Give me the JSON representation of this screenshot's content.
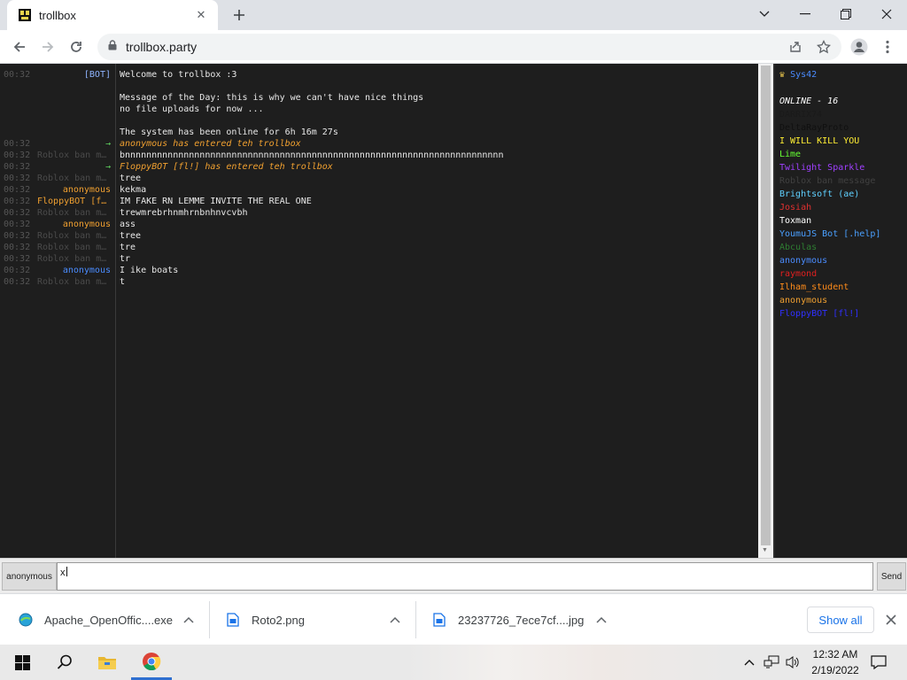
{
  "browser": {
    "tab_title": "trollbox",
    "url": "trollbox.party"
  },
  "chat": {
    "messages": [
      {
        "time": "00:32",
        "nick": "[BOT]",
        "nick_color": "#8fb5ff",
        "text": "Welcome to trollbox :3",
        "text_color": "#e8e8e8",
        "italic": false
      },
      {
        "time": "",
        "nick": "",
        "nick_color": "#8fb5ff",
        "text": "",
        "text_color": "#e8e8e8",
        "italic": false
      },
      {
        "time": "",
        "nick": "",
        "nick_color": "#8fb5ff",
        "text": "Message of the Day: this is why we can't have nice things",
        "text_color": "#e8e8e8",
        "italic": false
      },
      {
        "time": "",
        "nick": "",
        "nick_color": "#8fb5ff",
        "text": "no file uploads for now ...",
        "text_color": "#e8e8e8",
        "italic": false
      },
      {
        "time": "",
        "nick": "",
        "nick_color": "#8fb5ff",
        "text": "",
        "text_color": "#e8e8e8",
        "italic": false
      },
      {
        "time": "",
        "nick": "",
        "nick_color": "#8fb5ff",
        "text": "The system has been online for 6h 16m 27s",
        "text_color": "#e8e8e8",
        "italic": false
      },
      {
        "time": "00:32",
        "nick": "→",
        "nick_color": "#5fd35f",
        "text": "anonymous has entered teh trollbox",
        "text_color": "#f0a030",
        "italic": true
      },
      {
        "time": "00:32",
        "nick": "Roblox ban m...",
        "nick_color": "#4a4a4a",
        "text": "bnnnnnnnnnnnnnnnnnnnnnnnnnnnnnnnnnnnnnnnnnnnnnnnnnnnnnnnnnnnnnnnnnnnnnnn",
        "text_color": "#e8e8e8",
        "italic": false
      },
      {
        "time": "00:32",
        "nick": "→",
        "nick_color": "#5fd35f",
        "text": "FloppyBOT [fl!] has entered teh trollbox",
        "text_color": "#f0a030",
        "italic": true
      },
      {
        "time": "00:32",
        "nick": "Roblox ban m...",
        "nick_color": "#4a4a4a",
        "text": "tree",
        "text_color": "#e8e8e8",
        "italic": false
      },
      {
        "time": "00:32",
        "nick": "anonymous",
        "nick_color": "#f0a030",
        "text": "kekma",
        "text_color": "#e8e8e8",
        "italic": false
      },
      {
        "time": "00:32",
        "nick": "FloppyBOT [fl...",
        "nick_color": "#f0a030",
        "text": "IM FAKE RN LEMME INVITE THE REAL ONE",
        "text_color": "#e8e8e8",
        "italic": false
      },
      {
        "time": "00:32",
        "nick": "Roblox ban m...",
        "nick_color": "#4a4a4a",
        "text": "trewmrebrhnmhrnbnhnvcvbh",
        "text_color": "#e8e8e8",
        "italic": false
      },
      {
        "time": "00:32",
        "nick": "anonymous",
        "nick_color": "#f0a030",
        "text": "ass",
        "text_color": "#e8e8e8",
        "italic": false
      },
      {
        "time": "00:32",
        "nick": "Roblox ban m...",
        "nick_color": "#4a4a4a",
        "text": "tree",
        "text_color": "#e8e8e8",
        "italic": false
      },
      {
        "time": "00:32",
        "nick": "Roblox ban m...",
        "nick_color": "#4a4a4a",
        "text": "tre",
        "text_color": "#e8e8e8",
        "italic": false
      },
      {
        "time": "00:32",
        "nick": "Roblox ban m...",
        "nick_color": "#4a4a4a",
        "text": "tr",
        "text_color": "#e8e8e8",
        "italic": false
      },
      {
        "time": "00:32",
        "nick": "anonymous",
        "nick_color": "#4a8cff",
        "text": "I ike boats",
        "text_color": "#e8e8e8",
        "italic": false
      },
      {
        "time": "00:32",
        "nick": "Roblox ban m...",
        "nick_color": "#4a4a4a",
        "text": "t",
        "text_color": "#e8e8e8",
        "italic": false
      }
    ]
  },
  "sidebar": {
    "owner": "Sys42",
    "owner_color": "#4a8cff",
    "online_header": "ONLINE - 16",
    "users": [
      {
        "name": "DARRIX74",
        "color": "#1a1a1a"
      },
      {
        "name": "DeltaRayProto",
        "color": "#101010"
      },
      {
        "name": "I WILL KILL YOU",
        "color": "#ffee33"
      },
      {
        "name": "Lime",
        "color": "#66ff33"
      },
      {
        "name": "Twilight Sparkle",
        "color": "#a040ff"
      },
      {
        "name": "Roblox ban message",
        "color": "#404040"
      },
      {
        "name": "Brightsoft (ae)",
        "color": "#5fd0ff"
      },
      {
        "name": "Josiah",
        "color": "#e03030"
      },
      {
        "name": "Toxman",
        "color": "#ffffff"
      },
      {
        "name": "YoumuJS Bot [.help]",
        "color": "#4aa0ff"
      },
      {
        "name": "Abculas",
        "color": "#2e7d32"
      },
      {
        "name": "anonymous",
        "color": "#4a8cff"
      },
      {
        "name": "raymond",
        "color": "#e02020"
      },
      {
        "name": "Ilham_student",
        "color": "#ff8c1a"
      },
      {
        "name": "anonymous",
        "color": "#f0a030"
      },
      {
        "name": "FloppyBOT [fl!]",
        "color": "#3030ff"
      }
    ]
  },
  "input": {
    "nick_label": "anonymous",
    "value": "x",
    "send_label": "Send"
  },
  "downloads": {
    "items": [
      {
        "name": "Apache_OpenOffic....exe"
      },
      {
        "name": "Roto2.png"
      },
      {
        "name": "23237726_7ece7cf....jpg"
      }
    ],
    "show_all_label": "Show all"
  },
  "taskbar": {
    "time": "12:32 AM",
    "date": "2/19/2022"
  }
}
